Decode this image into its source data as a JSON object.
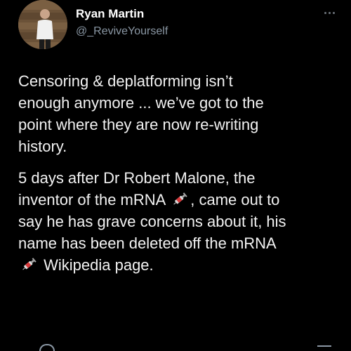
{
  "author": {
    "name": "Ryan Martin",
    "handle": "@_ReviveYourself",
    "avatar_icon": "profile-photo"
  },
  "more_icon": "ellipsis-icon",
  "tweet": {
    "paragraph_1": "Censoring & deplatforming isn’t\nenough anymore ... we’ve got to the\npoint where they are now re-writing\nhistory.",
    "paragraph_2": {
      "part_a": "5 days after Dr Robert Malone, the\ninventor of the mRNA",
      "emoji_1": "syringe-emoji",
      "part_b": ", came out to\nsay he has grave concerns about it, his\nname has been deleted off the mRNA\n",
      "emoji_2": "syringe-emoji",
      "part_c": " Wikipedia page."
    }
  },
  "colors": {
    "background": "#000000",
    "name": "#ffffff",
    "handle": "#8b98a5",
    "text": "#f2f2f2"
  }
}
